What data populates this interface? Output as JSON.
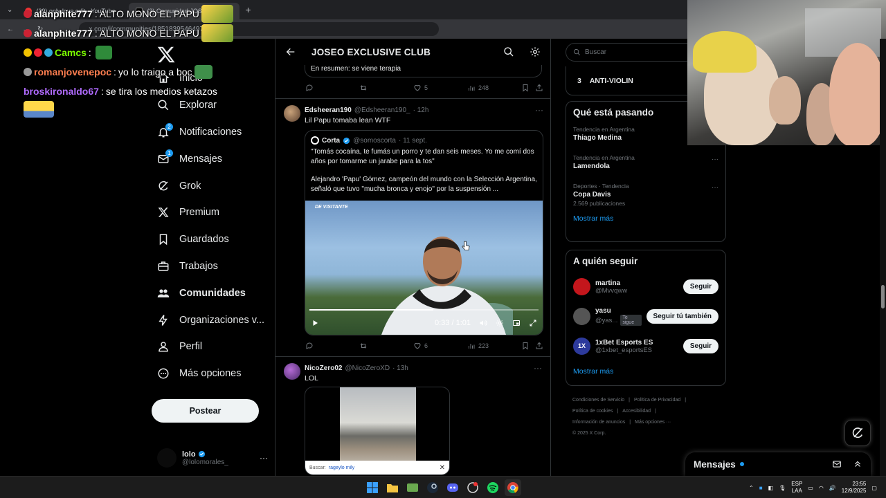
{
  "browser": {
    "tabs": [
      {
        "label": "(29) only love edit - YouTube"
      },
      {
        "label": "(3) Comunidad JOSEO EX..."
      }
    ],
    "new_tab": "+",
    "address": "x.com/i/communities/1851839546497805158"
  },
  "chat": [
    {
      "user": "alanphite777",
      "message": "ALTO MONO EL PAPU",
      "color": "#ffffff"
    },
    {
      "user": "alanphite777",
      "message": "ALTO MONO EL PAPU",
      "color": "#ffffff"
    },
    {
      "user": "Camcs",
      "message": "",
      "color": "#7cfc00"
    },
    {
      "user": "romanjovenepoc",
      "message": "yo lo traigo a boc",
      "color": "#ff7f50"
    },
    {
      "user": "broskironaldo67",
      "message": "se tira los medios ketazos",
      "color": "#b06bff"
    }
  ],
  "nav": {
    "items": [
      {
        "label": "Inicio",
        "icon": "home-icon"
      },
      {
        "label": "Explorar",
        "icon": "search-icon"
      },
      {
        "label": "Notificaciones",
        "icon": "bell-icon",
        "badge": "2"
      },
      {
        "label": "Mensajes",
        "icon": "mail-icon",
        "badge": "1"
      },
      {
        "label": "Grok",
        "icon": "grok-icon"
      },
      {
        "label": "Premium",
        "icon": "x-logo-icon"
      },
      {
        "label": "Guardados",
        "icon": "bookmark-icon"
      },
      {
        "label": "Trabajos",
        "icon": "briefcase-icon"
      },
      {
        "label": "Comunidades",
        "icon": "people-icon"
      },
      {
        "label": "Organizaciones v...",
        "icon": "lightning-icon"
      },
      {
        "label": "Perfil",
        "icon": "person-icon"
      },
      {
        "label": "Más opciones",
        "icon": "more-circle-icon"
      }
    ],
    "post_button": "Postear",
    "account": {
      "name": "lolo",
      "handle": "@lolomorales_",
      "more": "···"
    }
  },
  "main": {
    "title": "JOSEO EXCLUSIVE CLUB",
    "prev_quote_text": "En resumen: se viene terapia",
    "prev_actions": {
      "replies": "",
      "reposts": "",
      "likes": "5",
      "views": "248"
    },
    "tweets": [
      {
        "name": "Edsheeran190",
        "handle": "@Edsheeran190_",
        "time": "· 12h",
        "text": "Lil Papu tomaba lean WTF",
        "quote": {
          "name": "Corta",
          "handle": "@somoscorta",
          "time": "· 11 sept.",
          "text1": "\"Tomás cocaína, te fumás un porro y te dan seis meses. Yo me comí dos años por tomarme un jarabe para la tos\"",
          "text2": "Alejandro 'Papu' Gómez, campeón del mundo con la Selección Argentina, señaló que tuvo \"mucha bronca y enojo\" por la suspensión ...",
          "video_watermark": "DE VISITANTE",
          "video_time": "0:33 / 1:01",
          "progress": 0.54
        },
        "actions": {
          "replies": "",
          "reposts": "",
          "likes": "6",
          "views": "223"
        }
      },
      {
        "name": "NicoZero02",
        "handle": "@NicoZeroXD",
        "time": "· 13h",
        "text": "LOL",
        "search_label": "Buscar:",
        "search_query": "rageylo mily"
      }
    ]
  },
  "sidebar": {
    "search_placeholder": "Buscar",
    "anti_rank": "3",
    "anti_label": "ANTI-VIOLIN",
    "trends_title": "Qué está pasando",
    "trends": [
      {
        "context": "Tendencia en Argentina",
        "name": "Thiago Medina",
        "sub": ""
      },
      {
        "context": "Tendencia en Argentina",
        "name": "Lamendola",
        "sub": ""
      },
      {
        "context": "Deportes · Tendencia",
        "name": "Copa Davis",
        "sub": "2.569 publicaciones"
      }
    ],
    "show_more": "Mostrar más",
    "who_title": "A quién seguir",
    "who": [
      {
        "name": "martina",
        "handle": "@Mvvqww",
        "button": "Seguir",
        "color": "#c4161c"
      },
      {
        "name": "yasu",
        "handle": "@yas...",
        "follows_you": "Te sigue",
        "button": "Seguir tú también",
        "color": "#555555"
      },
      {
        "name": "1xBet Esports ES",
        "handle": "@1xbet_esportsES",
        "button": "Seguir",
        "color": "#2d3a9c"
      }
    ],
    "who_show_more": "Mostrar más",
    "footer": [
      "Condiciones de Servicio",
      "|",
      "Política de Privacidad",
      "|",
      "Política de cookies",
      "|",
      "Accesibilidad",
      "|",
      "Información de anuncios",
      "|",
      "Más opciones ···",
      "© 2025 X Corp."
    ]
  },
  "messages_dock": {
    "title": "Mensajes"
  },
  "taskbar": {
    "lang1": "ESP",
    "lang2": "LAA",
    "time": "23:55",
    "date": "12/9/2025"
  },
  "colors": {
    "accent": "#1d9bf0",
    "background": "#000000",
    "border": "#2f3336",
    "muted": "#71767b"
  }
}
